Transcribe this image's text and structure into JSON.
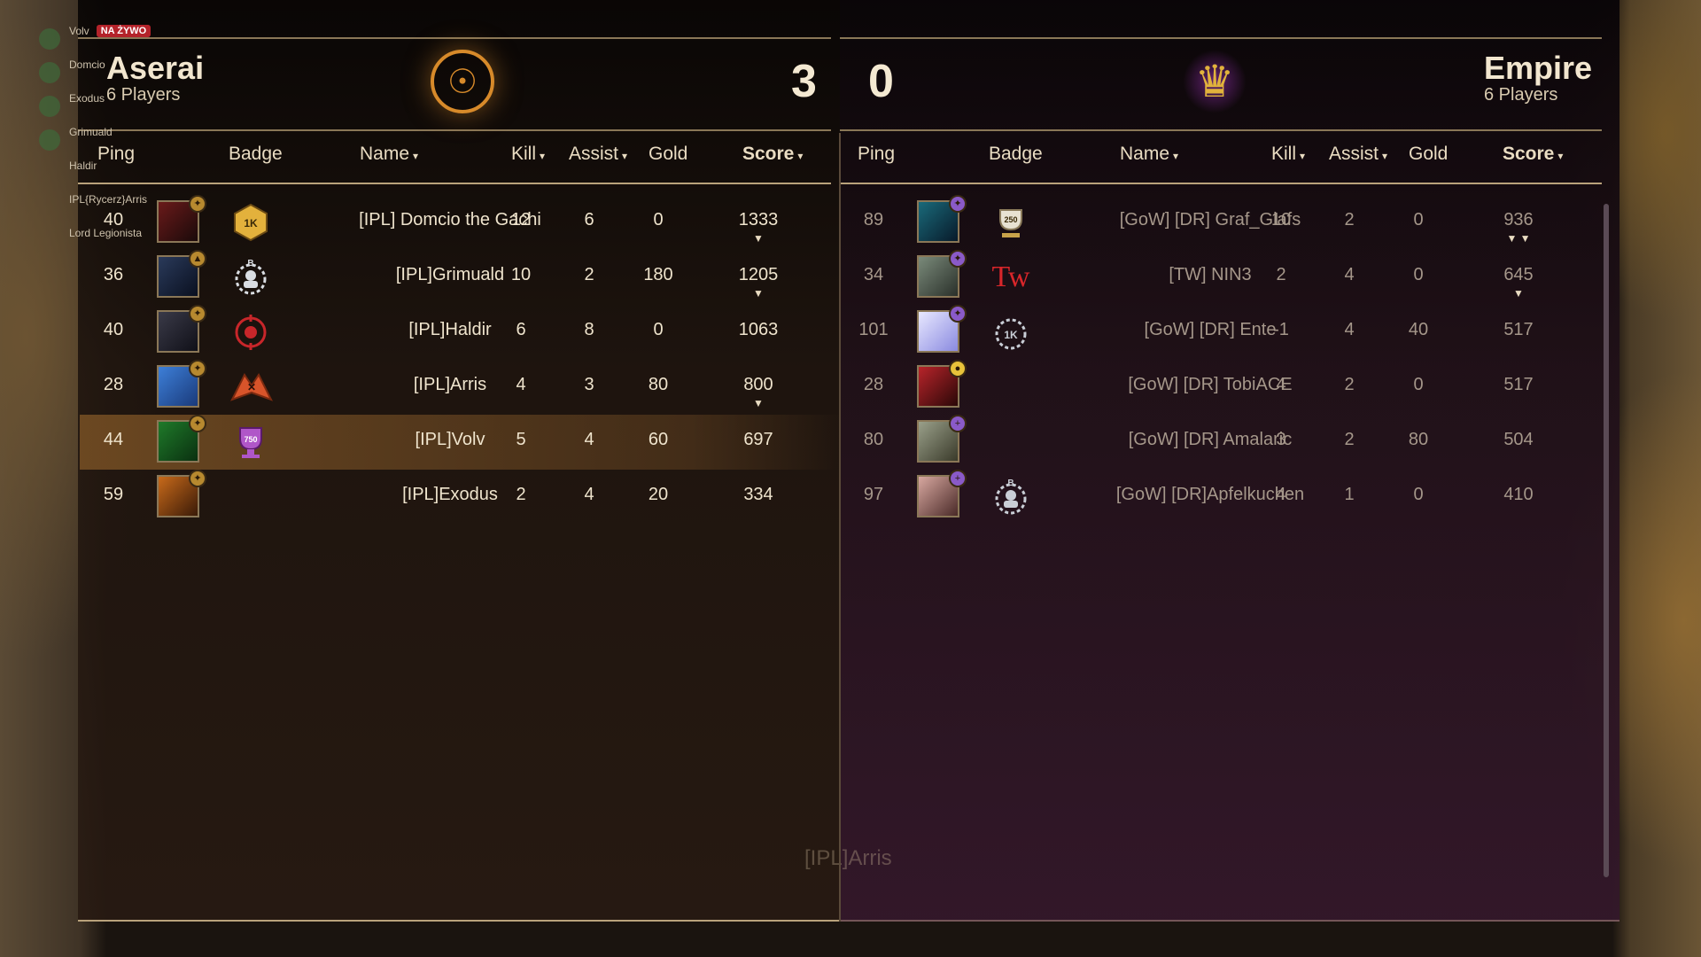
{
  "stream": {
    "entries": [
      "Volv",
      "Domcio",
      "Exodus",
      "Grimuald",
      "Haldir",
      "IPL{Rycerz}Arris",
      "Lord Legionista"
    ],
    "live_badge": "NA ŻYWO"
  },
  "left_team": {
    "name": "Aserai",
    "players": "6 Players",
    "score": "3",
    "emblem_icon": "aserai-sun-icon"
  },
  "right_team": {
    "name": "Empire",
    "players": "6 Players",
    "score": "0",
    "emblem_icon": "empire-eagle-icon"
  },
  "columns": {
    "ping": "Ping",
    "badge": "Badge",
    "name": "Name",
    "kill": "Kill",
    "assist": "Assist",
    "gold": "Gold",
    "score": "Score"
  },
  "left_players": [
    {
      "ping": "40",
      "badge": "1K",
      "name": "[IPL] Domcio the Gachi",
      "kill": "12",
      "assist": "6",
      "gold": "0",
      "score": "1333",
      "marks": "▼"
    },
    {
      "ping": "36",
      "badge": "B",
      "name": "[IPL]Grimuald",
      "kill": "10",
      "assist": "2",
      "gold": "180",
      "score": "1205",
      "marks": "▼"
    },
    {
      "ping": "40",
      "badge": "✦",
      "name": "[IPL]Haldir",
      "kill": "6",
      "assist": "8",
      "gold": "0",
      "score": "1063",
      "marks": ""
    },
    {
      "ping": "28",
      "badge": "✕",
      "name": "[IPL]Arris",
      "kill": "4",
      "assist": "3",
      "gold": "80",
      "score": "800",
      "marks": "▼"
    },
    {
      "ping": "44",
      "badge": "750",
      "name": "[IPL]Volv",
      "kill": "5",
      "assist": "4",
      "gold": "60",
      "score": "697",
      "marks": ""
    },
    {
      "ping": "59",
      "badge": "",
      "name": "[IPL]Exodus",
      "kill": "2",
      "assist": "4",
      "gold": "20",
      "score": "334",
      "marks": ""
    }
  ],
  "right_players": [
    {
      "ping": "89",
      "badge": "250",
      "name": "[GoW] [DR] Graf_Glafs",
      "kill": "10",
      "assist": "2",
      "gold": "0",
      "score": "936",
      "marks": "▼ ▼"
    },
    {
      "ping": "34",
      "badge": "Tw",
      "name": "[TW] NIN3",
      "kill": "2",
      "assist": "4",
      "gold": "0",
      "score": "645",
      "marks": "▼"
    },
    {
      "ping": "101",
      "badge": "1K",
      "name": "[GoW] [DR] Ente",
      "kill": "-1",
      "assist": "4",
      "gold": "40",
      "score": "517",
      "marks": ""
    },
    {
      "ping": "28",
      "badge": "",
      "name": "[GoW] [DR] TobiACE",
      "kill": "4",
      "assist": "2",
      "gold": "0",
      "score": "517",
      "marks": ""
    },
    {
      "ping": "80",
      "badge": "",
      "name": "[GoW] [DR] Amalaric",
      "kill": "3",
      "assist": "2",
      "gold": "80",
      "score": "504",
      "marks": ""
    },
    {
      "ping": "97",
      "badge": "B",
      "name": "[GoW] [DR]Apfelkuchen",
      "kill": "4",
      "assist": "1",
      "gold": "0",
      "score": "410",
      "marks": ""
    }
  ],
  "spectating": "[IPL]Arris",
  "colors": {
    "accent": "#b9a27b",
    "aserai": "#d78a2a",
    "empire": "#e1b23c",
    "highlight_row": "#78502a"
  }
}
